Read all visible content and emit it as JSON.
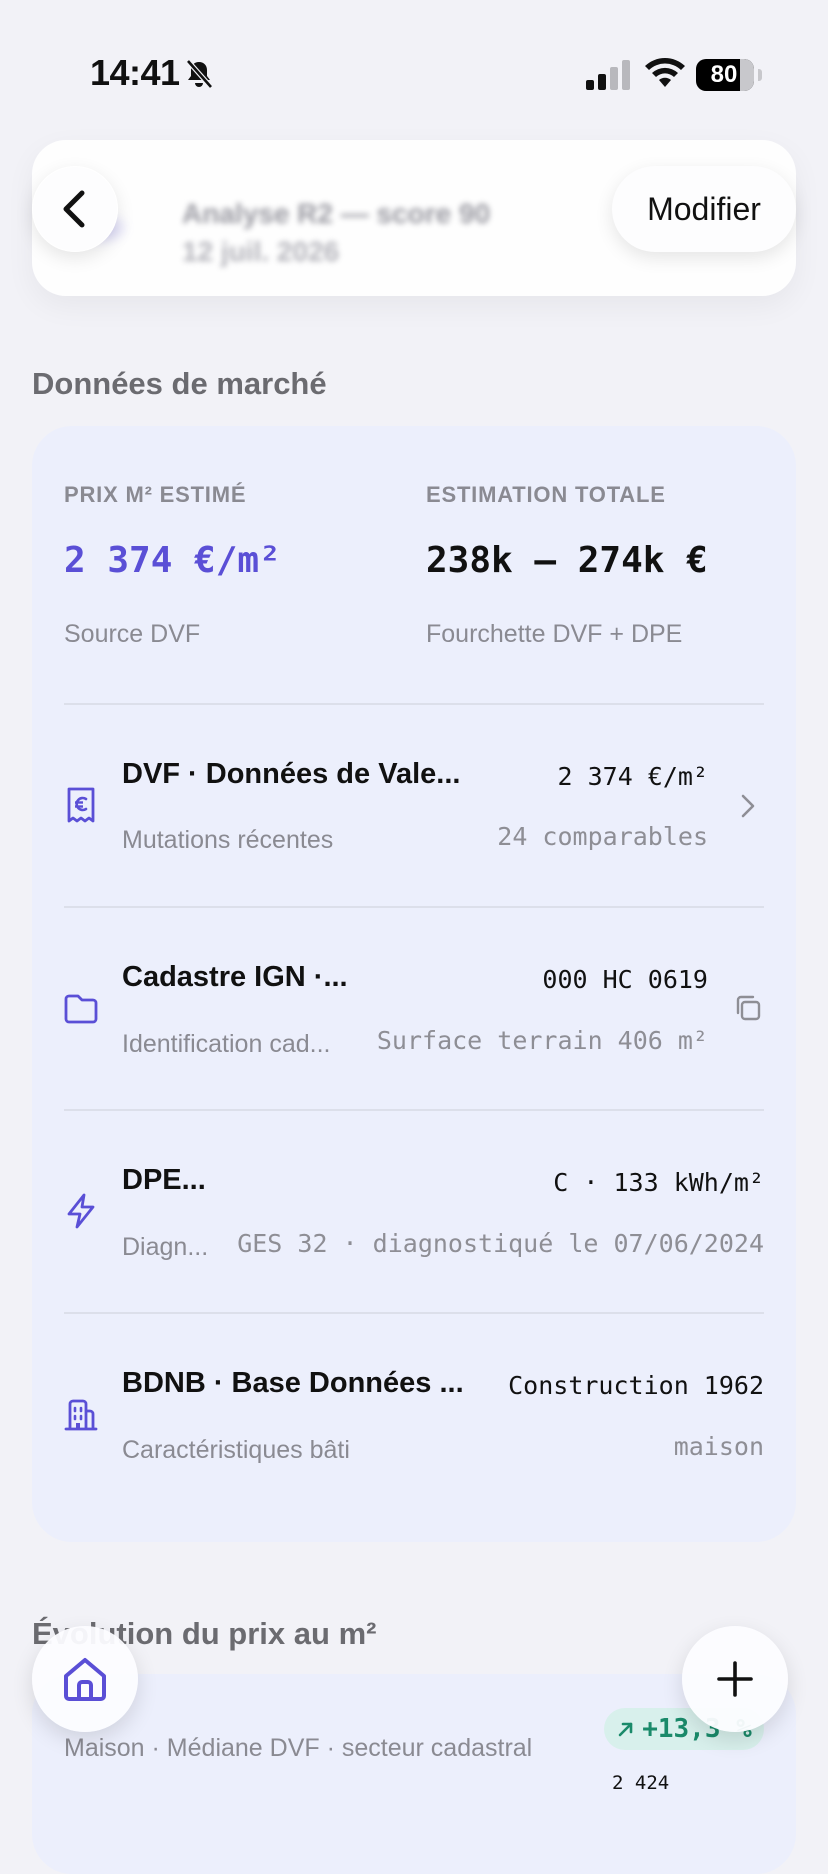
{
  "status_bar": {
    "time": "14:41",
    "battery": "80"
  },
  "header": {
    "back_icon": "chevron-left-icon",
    "modify_label": "Modifier",
    "title": "Analyse R2 — score 90",
    "date": "12 juil. 2026"
  },
  "market": {
    "section_title": "Données de marché",
    "price": {
      "label": "PRIX M² ESTIMÉ",
      "value": "2 374 €/m²",
      "sub": "Source DVF"
    },
    "total": {
      "label": "ESTIMATION TOTALE",
      "value": "238k – 274k €",
      "sub": "Fourchette DVF + DPE"
    },
    "rows": [
      {
        "icon": "receipt-euro-icon",
        "title": "DVF · Données de Vale...",
        "subtitle": "Mutations récentes",
        "value": "2 374 €/m²",
        "value2": "24 comparables",
        "trailing_icon": "chevron-right-icon"
      },
      {
        "icon": "folder-icon",
        "title": "Cadastre IGN ·...",
        "subtitle": "Identification cad...",
        "value": "000 HC 0619",
        "value2": "Surface terrain 406 m²",
        "trailing_icon": "copy-icon"
      },
      {
        "icon": "lightning-icon",
        "title": "DPE...",
        "subtitle": "Diagn...",
        "value": "C · 133 kWh/m²",
        "value2": "GES 32 · diagnostiqué le 07/06/2024"
      },
      {
        "icon": "building-icon",
        "title": "BDNB · Base Données ...",
        "subtitle": "Caractéristiques bâti",
        "value": "Construction 1962",
        "value2": "maison"
      }
    ]
  },
  "evolution": {
    "section_title": "Évolution du prix au m²",
    "subtitle": "Maison · Médiane DVF · secteur cadastral",
    "trend": "+13,3 %",
    "trend_icon": "arrow-up-right-icon",
    "y_tick": "2 424"
  },
  "nav": {
    "home_icon": "home-icon",
    "add_icon": "plus-icon"
  },
  "colors": {
    "accent": "#5a4fd6",
    "card_bg": "#eceffc",
    "trend_green": "#1a8a6a"
  }
}
